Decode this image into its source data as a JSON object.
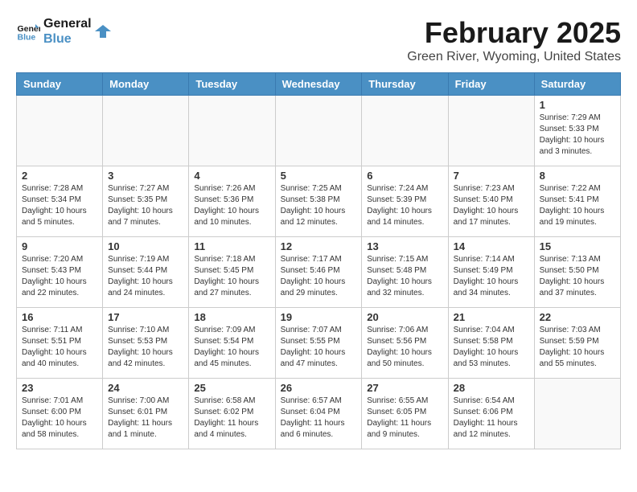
{
  "header": {
    "logo_line1": "General",
    "logo_line2": "Blue",
    "title": "February 2025",
    "subtitle": "Green River, Wyoming, United States"
  },
  "weekdays": [
    "Sunday",
    "Monday",
    "Tuesday",
    "Wednesday",
    "Thursday",
    "Friday",
    "Saturday"
  ],
  "weeks": [
    [
      {
        "day": "",
        "info": ""
      },
      {
        "day": "",
        "info": ""
      },
      {
        "day": "",
        "info": ""
      },
      {
        "day": "",
        "info": ""
      },
      {
        "day": "",
        "info": ""
      },
      {
        "day": "",
        "info": ""
      },
      {
        "day": "1",
        "info": "Sunrise: 7:29 AM\nSunset: 5:33 PM\nDaylight: 10 hours\nand 3 minutes."
      }
    ],
    [
      {
        "day": "2",
        "info": "Sunrise: 7:28 AM\nSunset: 5:34 PM\nDaylight: 10 hours\nand 5 minutes."
      },
      {
        "day": "3",
        "info": "Sunrise: 7:27 AM\nSunset: 5:35 PM\nDaylight: 10 hours\nand 7 minutes."
      },
      {
        "day": "4",
        "info": "Sunrise: 7:26 AM\nSunset: 5:36 PM\nDaylight: 10 hours\nand 10 minutes."
      },
      {
        "day": "5",
        "info": "Sunrise: 7:25 AM\nSunset: 5:38 PM\nDaylight: 10 hours\nand 12 minutes."
      },
      {
        "day": "6",
        "info": "Sunrise: 7:24 AM\nSunset: 5:39 PM\nDaylight: 10 hours\nand 14 minutes."
      },
      {
        "day": "7",
        "info": "Sunrise: 7:23 AM\nSunset: 5:40 PM\nDaylight: 10 hours\nand 17 minutes."
      },
      {
        "day": "8",
        "info": "Sunrise: 7:22 AM\nSunset: 5:41 PM\nDaylight: 10 hours\nand 19 minutes."
      }
    ],
    [
      {
        "day": "9",
        "info": "Sunrise: 7:20 AM\nSunset: 5:43 PM\nDaylight: 10 hours\nand 22 minutes."
      },
      {
        "day": "10",
        "info": "Sunrise: 7:19 AM\nSunset: 5:44 PM\nDaylight: 10 hours\nand 24 minutes."
      },
      {
        "day": "11",
        "info": "Sunrise: 7:18 AM\nSunset: 5:45 PM\nDaylight: 10 hours\nand 27 minutes."
      },
      {
        "day": "12",
        "info": "Sunrise: 7:17 AM\nSunset: 5:46 PM\nDaylight: 10 hours\nand 29 minutes."
      },
      {
        "day": "13",
        "info": "Sunrise: 7:15 AM\nSunset: 5:48 PM\nDaylight: 10 hours\nand 32 minutes."
      },
      {
        "day": "14",
        "info": "Sunrise: 7:14 AM\nSunset: 5:49 PM\nDaylight: 10 hours\nand 34 minutes."
      },
      {
        "day": "15",
        "info": "Sunrise: 7:13 AM\nSunset: 5:50 PM\nDaylight: 10 hours\nand 37 minutes."
      }
    ],
    [
      {
        "day": "16",
        "info": "Sunrise: 7:11 AM\nSunset: 5:51 PM\nDaylight: 10 hours\nand 40 minutes."
      },
      {
        "day": "17",
        "info": "Sunrise: 7:10 AM\nSunset: 5:53 PM\nDaylight: 10 hours\nand 42 minutes."
      },
      {
        "day": "18",
        "info": "Sunrise: 7:09 AM\nSunset: 5:54 PM\nDaylight: 10 hours\nand 45 minutes."
      },
      {
        "day": "19",
        "info": "Sunrise: 7:07 AM\nSunset: 5:55 PM\nDaylight: 10 hours\nand 47 minutes."
      },
      {
        "day": "20",
        "info": "Sunrise: 7:06 AM\nSunset: 5:56 PM\nDaylight: 10 hours\nand 50 minutes."
      },
      {
        "day": "21",
        "info": "Sunrise: 7:04 AM\nSunset: 5:58 PM\nDaylight: 10 hours\nand 53 minutes."
      },
      {
        "day": "22",
        "info": "Sunrise: 7:03 AM\nSunset: 5:59 PM\nDaylight: 10 hours\nand 55 minutes."
      }
    ],
    [
      {
        "day": "23",
        "info": "Sunrise: 7:01 AM\nSunset: 6:00 PM\nDaylight: 10 hours\nand 58 minutes."
      },
      {
        "day": "24",
        "info": "Sunrise: 7:00 AM\nSunset: 6:01 PM\nDaylight: 11 hours\nand 1 minute."
      },
      {
        "day": "25",
        "info": "Sunrise: 6:58 AM\nSunset: 6:02 PM\nDaylight: 11 hours\nand 4 minutes."
      },
      {
        "day": "26",
        "info": "Sunrise: 6:57 AM\nSunset: 6:04 PM\nDaylight: 11 hours\nand 6 minutes."
      },
      {
        "day": "27",
        "info": "Sunrise: 6:55 AM\nSunset: 6:05 PM\nDaylight: 11 hours\nand 9 minutes."
      },
      {
        "day": "28",
        "info": "Sunrise: 6:54 AM\nSunset: 6:06 PM\nDaylight: 11 hours\nand 12 minutes."
      },
      {
        "day": "",
        "info": ""
      }
    ]
  ]
}
